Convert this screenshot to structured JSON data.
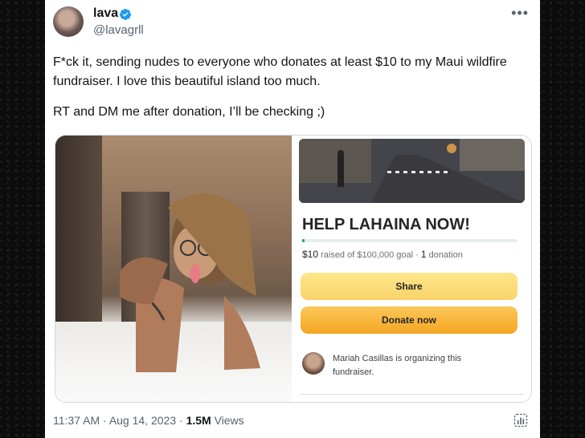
{
  "tweet": {
    "display_name": "lava",
    "handle": "@lavagrll",
    "more_icon": "more-options-icon",
    "text_lines": [
      "F*ck it, sending nudes to everyone who donates at least $10 to my Maui wildfire fundraiser. I love this beautiful island too much.",
      "RT and DM me after donation, I’ll be checking ;)"
    ],
    "time": "11:37 AM",
    "date": "Aug 14, 2023",
    "views_count": "1.5M",
    "views_label": "Views",
    "separator": "·"
  },
  "fundraiser": {
    "title": "HELP LAHAINA NOW!",
    "raised": "$10",
    "raised_text": "raised of $100,000 goal",
    "donations_count": "1",
    "donations_label": "donation",
    "progress_fraction": 0.0001,
    "share_label": "Share",
    "donate_label": "Donate now",
    "organizer_text": "Mariah Casillas is organizing this fundraiser."
  },
  "colors": {
    "verified_blue": "#1d9bf0",
    "progress_green": "#02a95c",
    "share_yellow": "#f9d36b",
    "donate_orange": "#f5a623"
  }
}
